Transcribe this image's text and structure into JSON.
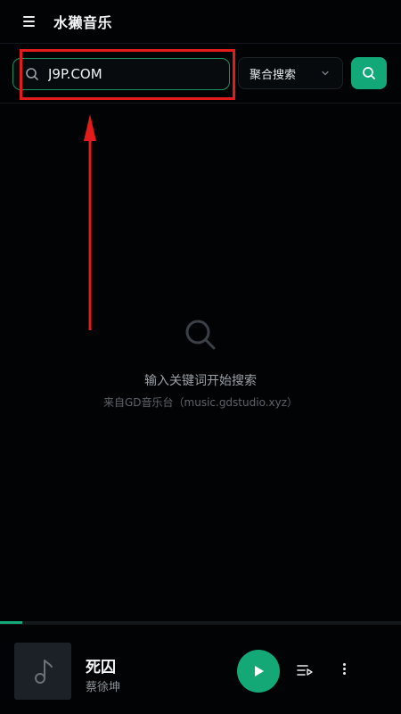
{
  "header": {
    "title": "水獭音乐",
    "menu_icon": "hamburger-menu-icon"
  },
  "search": {
    "value": "J9P.COM",
    "mode": "聚合搜索",
    "search_icon": "search-icon",
    "button_icon": "search-icon"
  },
  "empty_state": {
    "icon": "search-icon",
    "title": "输入关键词开始搜索",
    "subtitle": "来自GD音乐台（music.gdstudio.xyz）"
  },
  "player": {
    "progress": 0.055,
    "cover_icon": "music-note-icon",
    "song_title": "死囚",
    "artist": "蔡徐坤",
    "play_icon": "play-icon",
    "queue_icon": "playlist-icon",
    "more_icon": "more-vertical-icon"
  },
  "colors": {
    "accent": "#13a877",
    "annotation": "#e21b1b",
    "background": "#020305"
  }
}
